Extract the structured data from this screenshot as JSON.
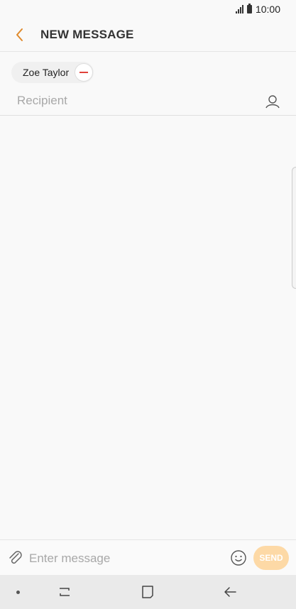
{
  "status_bar": {
    "time": "10:00"
  },
  "header": {
    "title": "NEW MESSAGE"
  },
  "recipients": {
    "chips": [
      {
        "name": "Zoe Taylor"
      }
    ],
    "input_placeholder": "Recipient"
  },
  "composer": {
    "placeholder": "Enter message",
    "send_label": "SEND"
  },
  "colors": {
    "accent": "#e08a2c",
    "send_button": "#fdd9a6",
    "remove_red": "#e0423a"
  },
  "icons": {
    "back": "chevron-left-icon",
    "contact": "person-icon",
    "attach": "paperclip-icon",
    "emoji": "smiley-icon",
    "nav_recent": "recent-apps-icon",
    "nav_home": "home-icon",
    "nav_back": "back-arrow-icon"
  }
}
